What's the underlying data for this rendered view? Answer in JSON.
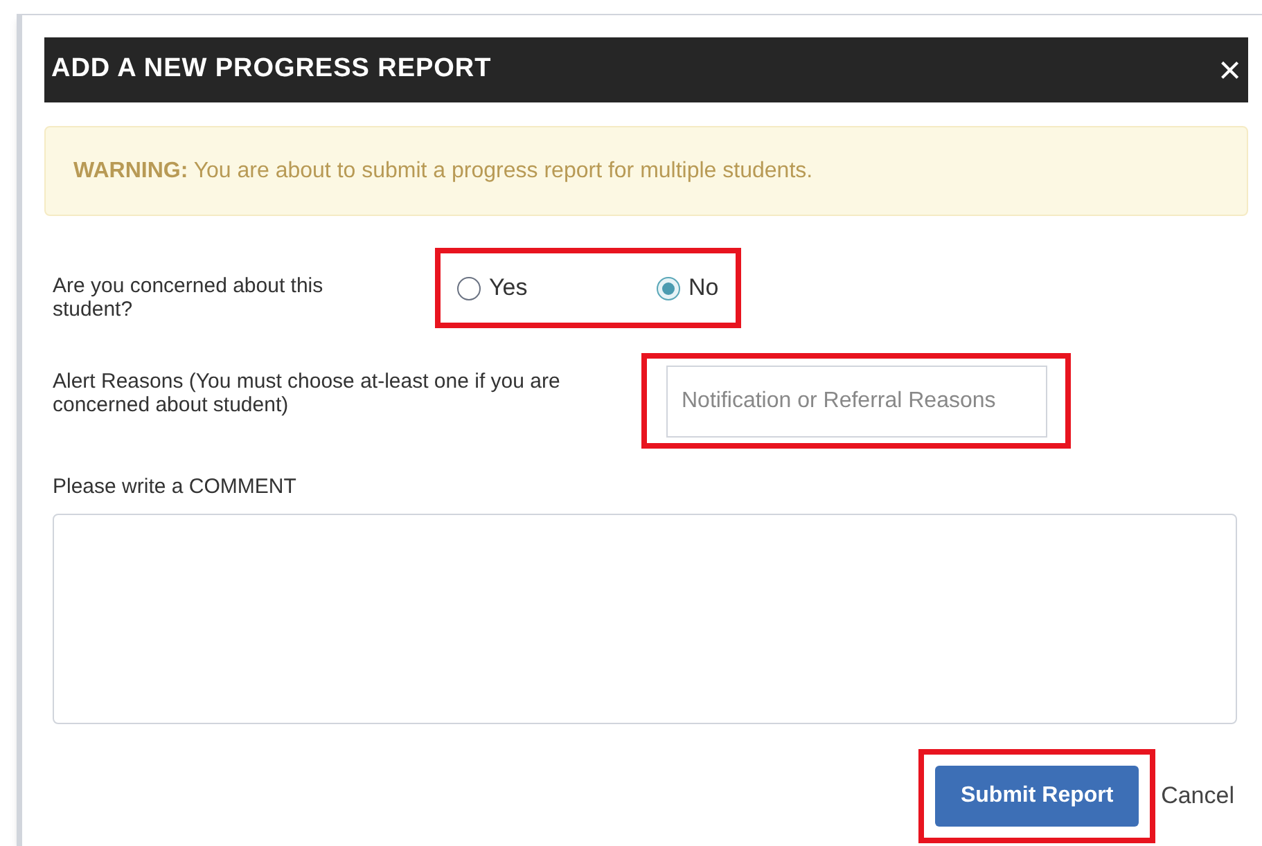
{
  "dialog": {
    "title": "ADD A NEW PROGRESS REPORT",
    "close": "×"
  },
  "warning": {
    "text": "**WARNING:** You are about to submit a progress report for multiple students."
  },
  "concern": {
    "label": "Are you concerned about this student?",
    "highlighted": true,
    "options": [
      {
        "label": "Yes",
        "selected": false
      },
      {
        "label": "No",
        "selected": true
      }
    ]
  },
  "alert_reasons": {
    "label": "Alert Reasons (You must choose at-least one if you are concerned about student)",
    "placeholder": "Notification or Referral Reasons",
    "highlighted": true
  },
  "comment": {
    "label": "Please write a COMMENT"
  },
  "buttons": [
    {
      "label": "Submit Report",
      "kind": "primary",
      "highlighted": true
    },
    {
      "label": "Cancel",
      "kind": "link",
      "highlighted": false
    }
  ]
}
